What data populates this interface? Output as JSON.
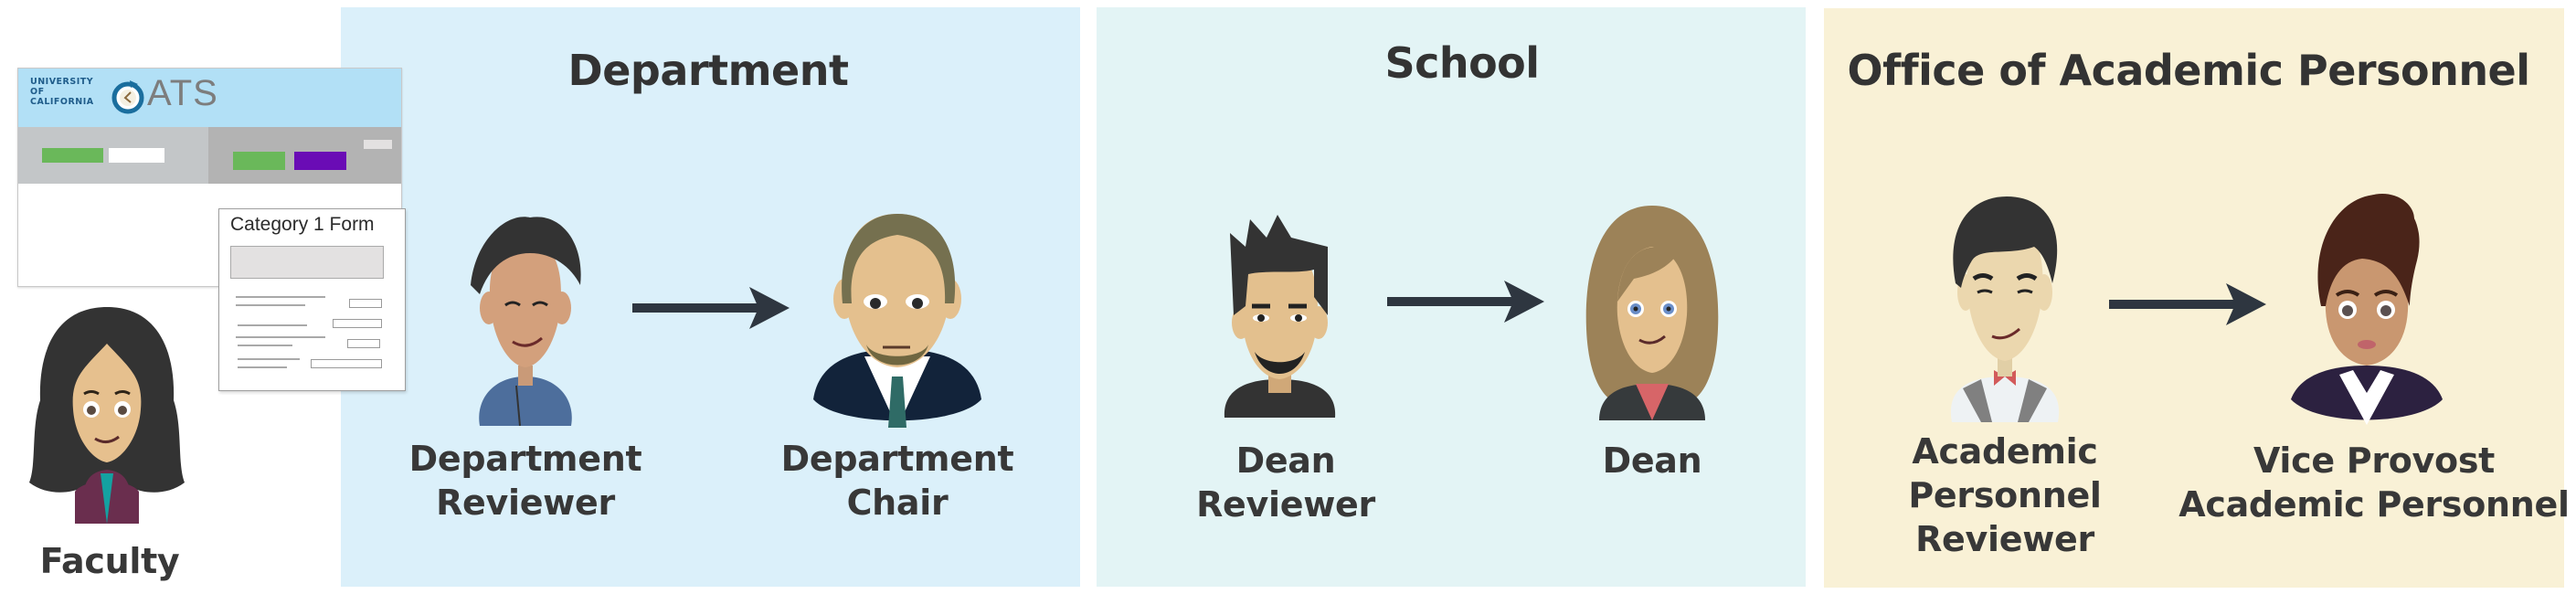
{
  "sections": {
    "department": {
      "title": "Department",
      "color": "#dbf0fa"
    },
    "school": {
      "title": "School",
      "color": "#e3f4f5"
    },
    "oap": {
      "title": "Office of Academic Personnel",
      "color": "#f9f1d6"
    }
  },
  "oats_window": {
    "org_lines": [
      "UNIVERSITY",
      "OF",
      "CALIFORNIA"
    ],
    "app_name": "ATS",
    "logo_icon": "clock-cycle-icon",
    "header_color": "#b2e0f6",
    "nav_buttons": [
      {
        "color": "#6ab85a"
      },
      {
        "color": "#ffffff"
      },
      {
        "color": "#6ab85a"
      },
      {
        "color": "#6a0cb5"
      },
      {
        "color": "#e3e1e1"
      }
    ]
  },
  "form_card": {
    "title": "Category 1 Form"
  },
  "roles": {
    "faculty": {
      "lines": [
        "Faculty"
      ],
      "icon": "faculty-avatar-icon"
    },
    "department_reviewer": {
      "lines": [
        "Department",
        "Reviewer"
      ],
      "icon": "department-reviewer-avatar-icon"
    },
    "department_chair": {
      "lines": [
        "Department",
        "Chair"
      ],
      "icon": "department-chair-avatar-icon"
    },
    "dean_reviewer": {
      "lines": [
        "Dean",
        "Reviewer"
      ],
      "icon": "dean-reviewer-avatar-icon"
    },
    "dean": {
      "lines": [
        "Dean"
      ],
      "icon": "dean-avatar-icon"
    },
    "ap_reviewer": {
      "lines": [
        "Academic",
        "Personnel",
        "Reviewer"
      ],
      "icon": "ap-reviewer-avatar-icon"
    },
    "vice_provost": {
      "lines": [
        "Vice Provost",
        "Academic Personnel"
      ],
      "icon": "vice-provost-avatar-icon"
    }
  },
  "flow": [
    {
      "from": "Department Reviewer",
      "to": "Department Chair"
    },
    {
      "from": "Dean Reviewer",
      "to": "Dean"
    },
    {
      "from": "Academic Personnel Reviewer",
      "to": "Vice Provost Academic Personnel"
    }
  ],
  "arrow_color": "#2e3640"
}
